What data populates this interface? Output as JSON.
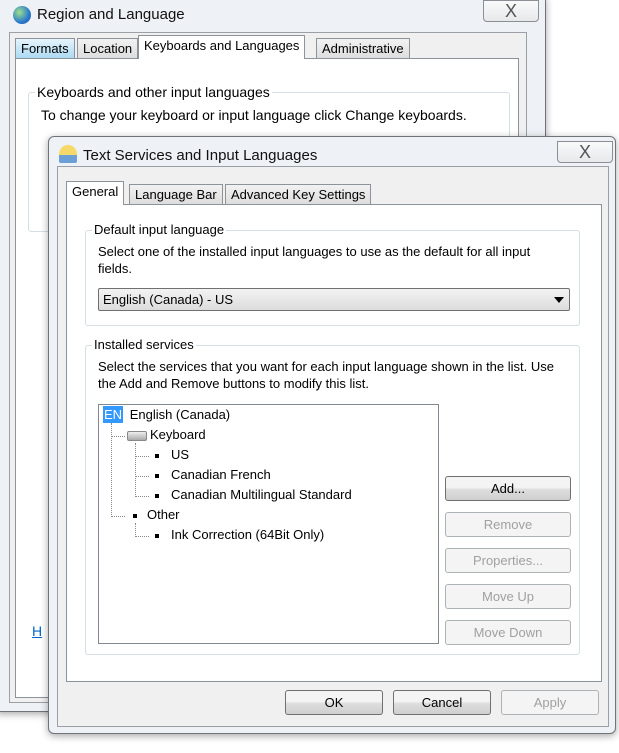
{
  "back_window": {
    "title": "Region and Language",
    "icon": "globe-icon",
    "close_label": "X",
    "tabs": [
      {
        "label": "Formats"
      },
      {
        "label": "Location"
      },
      {
        "label": "Keyboards and Languages",
        "selected": true
      },
      {
        "label": "Administrative"
      }
    ],
    "group_label": "Keyboards and other input languages",
    "description": "To change your keyboard or input language click Change keyboards.",
    "link_partial": "H"
  },
  "dialog": {
    "title": "Text Services and Input Languages",
    "icon": "text-services-icon",
    "close_label": "X",
    "tabs": [
      {
        "label": "General",
        "selected": true
      },
      {
        "label": "Language Bar"
      },
      {
        "label": "Advanced Key Settings"
      }
    ],
    "default_language": {
      "label": "Default input language",
      "description": "Select one of the installed input languages to use as the default for all input fields.",
      "selected": "English (Canada) - US"
    },
    "installed_services": {
      "label": "Installed services",
      "description": "Select the services that you want for each input language shown in the list. Use the Add and Remove buttons to modify this list.",
      "tree": {
        "language_badge": "EN",
        "language": "English (Canada)",
        "keyboard_label": "Keyboard",
        "keyboards": [
          "US",
          "Canadian French",
          "Canadian Multilingual Standard"
        ],
        "other_label": "Other",
        "other": [
          "Ink Correction (64Bit Only)"
        ]
      },
      "buttons": {
        "add": "Add...",
        "remove": "Remove",
        "properties": "Properties...",
        "move_up": "Move Up",
        "move_down": "Move Down"
      }
    },
    "footer": {
      "ok": "OK",
      "cancel": "Cancel",
      "apply": "Apply"
    }
  },
  "colors": {
    "selection": "#3399ff",
    "link": "#0066cc",
    "tab_highlight": "#a9d8f2"
  }
}
